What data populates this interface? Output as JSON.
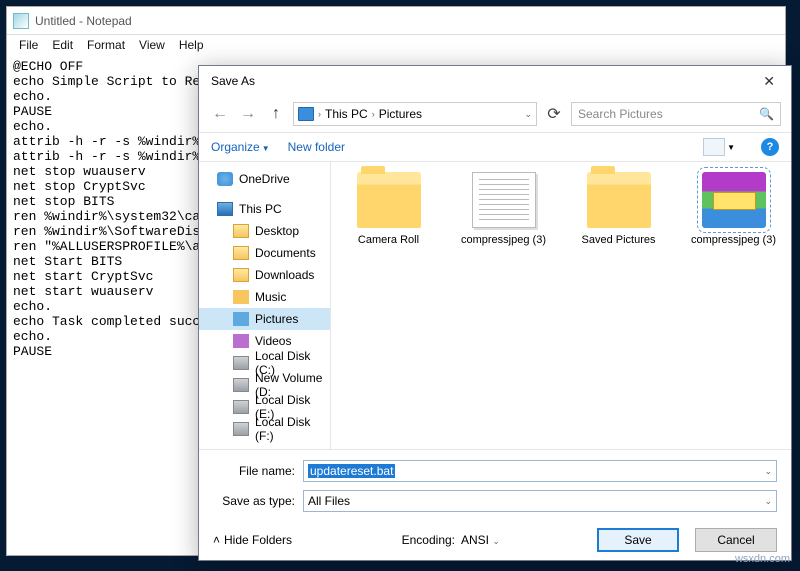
{
  "notepad": {
    "title": "Untitled - Notepad",
    "menu": {
      "file": "File",
      "edit": "Edit",
      "format": "Format",
      "view": "View",
      "help": "Help"
    },
    "body": "@ECHO OFF\necho Simple Script to Re\necho.\nPAUSE\necho.\nattrib -h -r -s %windir%\nattrib -h -r -s %windir%\nnet stop wuauserv\nnet stop CryptSvc\nnet stop BITS\nren %windir%\\system32\\ca\nren %windir%\\SoftwareDis\nren \"%ALLUSERSPROFILE%\\a\nnet Start BITS\nnet start CryptSvc\nnet start wuauserv\necho.\necho Task completed succ\necho.\nPAUSE"
  },
  "saveas": {
    "title": "Save As",
    "breadcrumb": {
      "root": "This PC",
      "current": "Pictures"
    },
    "search_placeholder": "Search Pictures",
    "toolbar": {
      "organize": "Organize",
      "newfolder": "New folder"
    },
    "tree": {
      "onedrive": "OneDrive",
      "thispc": "This PC",
      "desktop": "Desktop",
      "documents": "Documents",
      "downloads": "Downloads",
      "music": "Music",
      "pictures": "Pictures",
      "videos": "Videos",
      "diskc": "Local Disk (C:)",
      "diskd": "New Volume (D:",
      "diske": "Local Disk (E:)",
      "diskf": "Local Disk (F:)"
    },
    "files": {
      "f1": "Camera Roll",
      "f2": "compressjpeg (3)",
      "f3": "Saved Pictures",
      "f4": "compressjpeg (3)"
    },
    "labels": {
      "filename": "File name:",
      "saveastype": "Save as type:",
      "encoding": "Encoding:",
      "hidefolders": "Hide Folders"
    },
    "values": {
      "filename": "updatereset.bat",
      "saveastype": "All Files",
      "encoding": "ANSI"
    },
    "buttons": {
      "save": "Save",
      "cancel": "Cancel"
    }
  },
  "watermark": "wsxdn.com"
}
